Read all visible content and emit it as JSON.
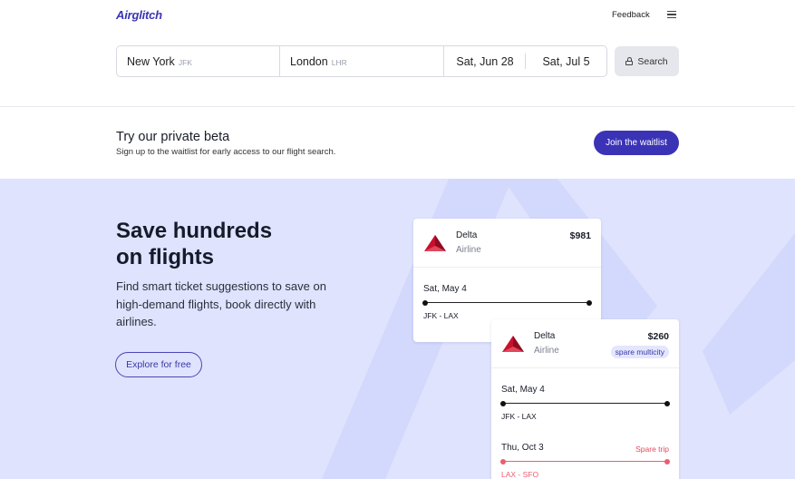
{
  "header": {
    "logo": "Airglitch",
    "feedback": "Feedback",
    "menu_icon": "hamburger-menu-icon"
  },
  "search": {
    "from_city": "New York",
    "from_code": "JFK",
    "to_city": "London",
    "to_code": "LHR",
    "depart_date": "Sat, Jun 28",
    "return_date": "Sat, Jul 5",
    "button_label": "Search",
    "button_icon": "lock-icon"
  },
  "beta": {
    "title": "Try our private beta",
    "subtitle": "Sign up to the waitlist for early access to our flight search.",
    "button_label": "Join the waitlist"
  },
  "hero": {
    "title_line1": "Save hundreds",
    "title_line2": "on flights",
    "text": "Find smart ticket suggestions to save on high-demand flights, book directly with airlines.",
    "button_label": "Explore for free"
  },
  "cards": [
    {
      "airline": "Delta",
      "type": "Airline",
      "price": "$981",
      "legs": [
        {
          "date": "Sat, May 4",
          "route": "JFK - LAX"
        }
      ]
    },
    {
      "airline": "Delta",
      "type": "Airline",
      "price": "$260",
      "tag": "spare multicity",
      "legs": [
        {
          "date": "Sat, May 4",
          "route": "JFK - LAX"
        },
        {
          "date": "Thu, Oct 3",
          "route": "LAX - SFO",
          "note": "Spare trip"
        }
      ]
    }
  ],
  "colors": {
    "brand": "#3b33b6",
    "hero_bg": "#dfe3fd",
    "spare_red": "#ef5b72",
    "delta_red": "#c8102e"
  }
}
